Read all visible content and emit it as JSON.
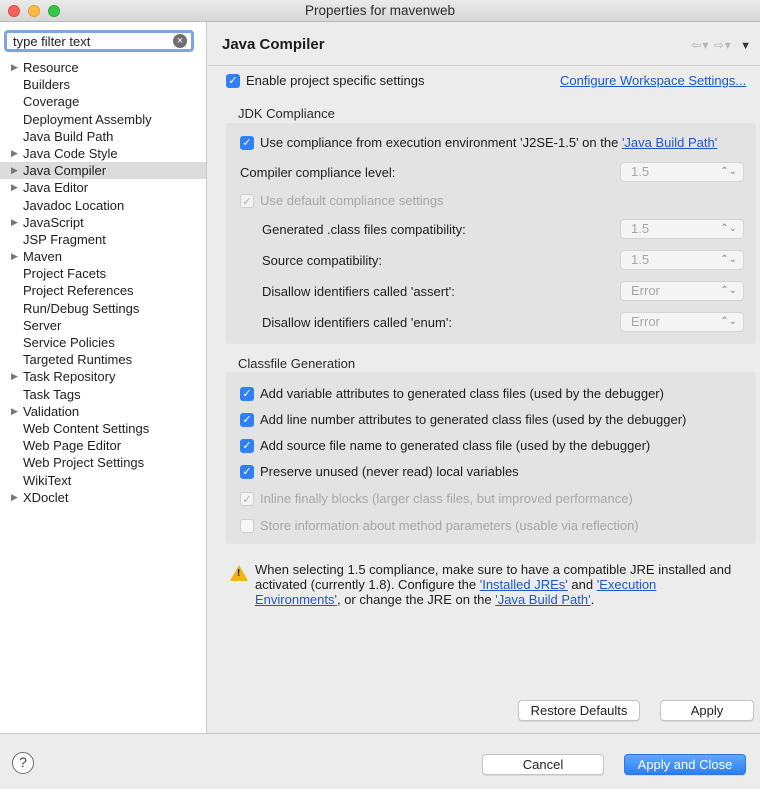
{
  "window": {
    "title": "Properties for mavenweb"
  },
  "filter": {
    "value": "type filter text"
  },
  "tree": [
    {
      "label": "Resource",
      "arrow": true
    },
    {
      "label": "Builders",
      "arrow": false
    },
    {
      "label": "Coverage",
      "arrow": false
    },
    {
      "label": "Deployment Assembly",
      "arrow": false
    },
    {
      "label": "Java Build Path",
      "arrow": false
    },
    {
      "label": "Java Code Style",
      "arrow": true
    },
    {
      "label": "Java Compiler",
      "arrow": true,
      "selected": true
    },
    {
      "label": "Java Editor",
      "arrow": true
    },
    {
      "label": "Javadoc Location",
      "arrow": false
    },
    {
      "label": "JavaScript",
      "arrow": true
    },
    {
      "label": "JSP Fragment",
      "arrow": false
    },
    {
      "label": "Maven",
      "arrow": true
    },
    {
      "label": "Project Facets",
      "arrow": false
    },
    {
      "label": "Project References",
      "arrow": false
    },
    {
      "label": "Run/Debug Settings",
      "arrow": false
    },
    {
      "label": "Server",
      "arrow": false
    },
    {
      "label": "Service Policies",
      "arrow": false
    },
    {
      "label": "Targeted Runtimes",
      "arrow": false
    },
    {
      "label": "Task Repository",
      "arrow": true
    },
    {
      "label": "Task Tags",
      "arrow": false
    },
    {
      "label": "Validation",
      "arrow": true
    },
    {
      "label": "Web Content Settings",
      "arrow": false
    },
    {
      "label": "Web Page Editor",
      "arrow": false
    },
    {
      "label": "Web Project Settings",
      "arrow": false
    },
    {
      "label": "WikiText",
      "arrow": false
    },
    {
      "label": "XDoclet",
      "arrow": true
    }
  ],
  "page": {
    "title": "Java Compiler",
    "enable_specific": "Enable project specific settings",
    "configure_link": "Configure Workspace Settings..."
  },
  "jdk": {
    "title": "JDK Compliance",
    "use_compliance_prefix": "Use compliance from execution environment 'J2SE-1.5' on the ",
    "use_compliance_link": "'Java Build Path'",
    "compliance_level_label": "Compiler compliance level:",
    "compliance_level_value": "1.5",
    "use_default": "Use default compliance settings",
    "generated_label": "Generated .class files compatibility:",
    "generated_value": "1.5",
    "source_label": "Source compatibility:",
    "source_value": "1.5",
    "assert_label": "Disallow identifiers called 'assert':",
    "assert_value": "Error",
    "enum_label": "Disallow identifiers called 'enum':",
    "enum_value": "Error"
  },
  "classfile": {
    "title": "Classfile Generation",
    "opt1": "Add variable attributes to generated class files (used by the debugger)",
    "opt2": "Add line number attributes to generated class files (used by the debugger)",
    "opt3": "Add source file name to generated class file (used by the debugger)",
    "opt4": "Preserve unused (never read) local variables",
    "opt5": "Inline finally blocks (larger class files, but improved performance)",
    "opt6": "Store information about method parameters (usable via reflection)"
  },
  "warning": {
    "line1": "When selecting 1.5 compliance, make sure to have a compatible JRE installed and",
    "line2_a": "activated (currently 1.8). Configure the ",
    "link_jres": "'Installed JREs'",
    "line2_b": " and ",
    "link_envs_1": "'Execution",
    "link_envs_2": "Environments'",
    "line3_a": ", or change the JRE on the ",
    "link_build": "'Java Build Path'",
    "line3_b": "."
  },
  "buttons": {
    "restore": "Restore Defaults",
    "apply": "Apply",
    "cancel": "Cancel",
    "apply_close": "Apply and Close",
    "help": "?"
  },
  "colors": {
    "accent": "#2f7ff5",
    "link": "#1f55c4",
    "warning": "#f0b316"
  }
}
